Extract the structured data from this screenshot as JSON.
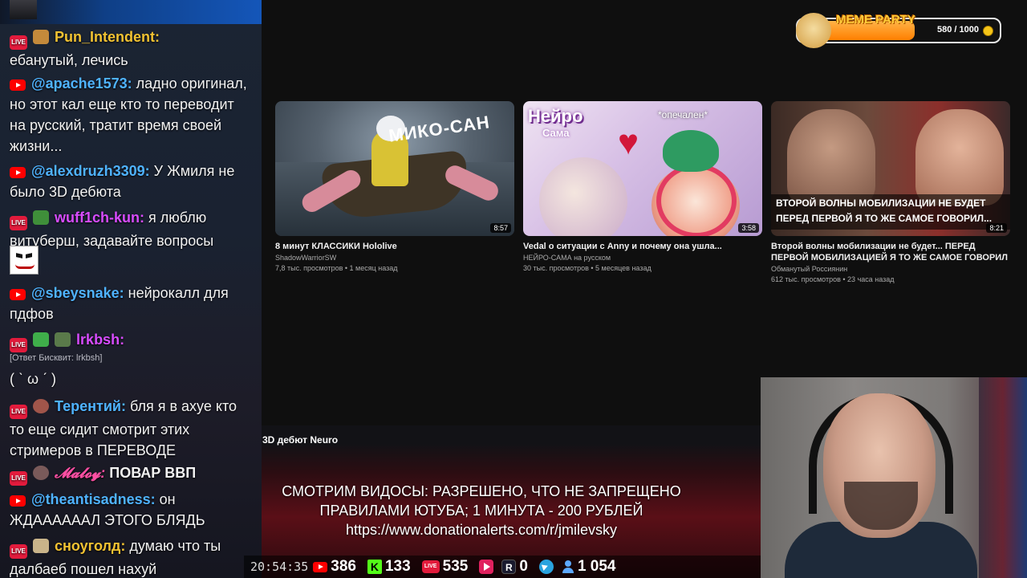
{
  "chat": {
    "messages": [
      {
        "nick": "Pun_Intendent",
        "nick_color": "#f1c232",
        "text": "ебанутый, лечись"
      },
      {
        "nick": "@apache1573:",
        "nick_color": "#4fb3ff",
        "text": "ладно оригинал, но этот кал еще кто то переводит на русский, тратит время своей жизни..."
      },
      {
        "nick": "@alexdruzh3309:",
        "nick_color": "#4fb3ff",
        "text": "У Жмиля не было 3D дебюта"
      },
      {
        "nick": "wuff1ch-kun:",
        "nick_color": "#d84cff",
        "text": "я люблю витуберш, задавайте вопросы"
      },
      {
        "nick": "@sbeysnake:",
        "nick_color": "#4fb3ff",
        "text": "нейрокалл для пдфов"
      },
      {
        "nick": "lrkbsh:",
        "nick_color": "#d84cff",
        "text": "( ˋ ω ˊ )",
        "reply": "[Ответ Бисквит: lrkbsh]"
      },
      {
        "nick": "Терентий:",
        "nick_color": "#4fb3ff",
        "text": "бля я в ахуе кто то еще сидит смотрит этих стримеров в ПЕРЕВОДЕ"
      },
      {
        "nick": "𝓜𝓪𝓵𝓸𝔂:",
        "nick_color": "#ff4fa3",
        "text": "ПОВАР ВВП"
      },
      {
        "nick": "@theantisadness:",
        "nick_color": "#4fb3ff",
        "text": "он ЖДААААААЛ ЭТОГО БЛЯДЬ"
      },
      {
        "nick": "сноуголд:",
        "nick_color": "#f1c232",
        "text": "думаю что ты далбаеб пошел нахуй"
      }
    ]
  },
  "youtube": {
    "videos": [
      {
        "title": "8 минут КЛАССИКИ Hololive",
        "channel": "ShadowWarriorSW",
        "meta": "7,8 тыс. просмотров • 1 месяц назад",
        "duration": "8:57",
        "thumb_text": "МИКО-САН"
      },
      {
        "title": "Vedal о ситуации с Anny и почему она ушла...",
        "channel": "НЕЙРО-САМА на русском",
        "meta": "30 тыс. просмотров • 5 месяцев назад",
        "duration": "3:58",
        "thumb_logo": "Нейро",
        "thumb_logo2": "Сама",
        "thumb_text": "*опечален*"
      },
      {
        "title": "Второй волны мобилизации не будет... ПЕРЕД ПЕРВОЙ МОБИЛИЗАЦИЕЙ Я ТО ЖЕ САМОЕ ГОВОРИЛ",
        "channel": "Обманутый Россиянин",
        "meta": "612 тыс. просмотров • 23 часа назад",
        "duration": "8:21",
        "thumb_caption_1": "ВТОРОЙ ВОЛНЫ МОБИЛИЗАЦИИ НЕ БУДЕТ",
        "thumb_caption_2": "ПЕРЕД ПЕРВОЙ Я ТО ЖЕ САМОЕ ГОВОРИЛ..."
      }
    ],
    "current_video_title": "3D дебют Neuro"
  },
  "meme_party": {
    "label": "MEME PARTY",
    "progress_text": "580 / 1000",
    "progress_fraction": 0.58
  },
  "donation": {
    "line1": "СМОТРИМ ВИДОСЫ: РАЗРЕШЕНО, ЧТО НЕ ЗАПРЕЩЕНО",
    "line2": "ПРАВИЛАМИ ЮТУБА; 1 МИНУТА - 200 РУБЛЕЙ",
    "line3": "https://www.donationalerts.com/r/jmilevsky"
  },
  "stats": {
    "clock": "20:54:35",
    "youtube": "386",
    "kick": "133",
    "vk": "535",
    "rutube": "0",
    "total_viewers": "1 054"
  },
  "colors": {
    "youtube_red": "#ff0000",
    "kick_green": "#53fc18",
    "vk_red": "#e21b3c",
    "telegram_blue": "#2aa3df"
  }
}
